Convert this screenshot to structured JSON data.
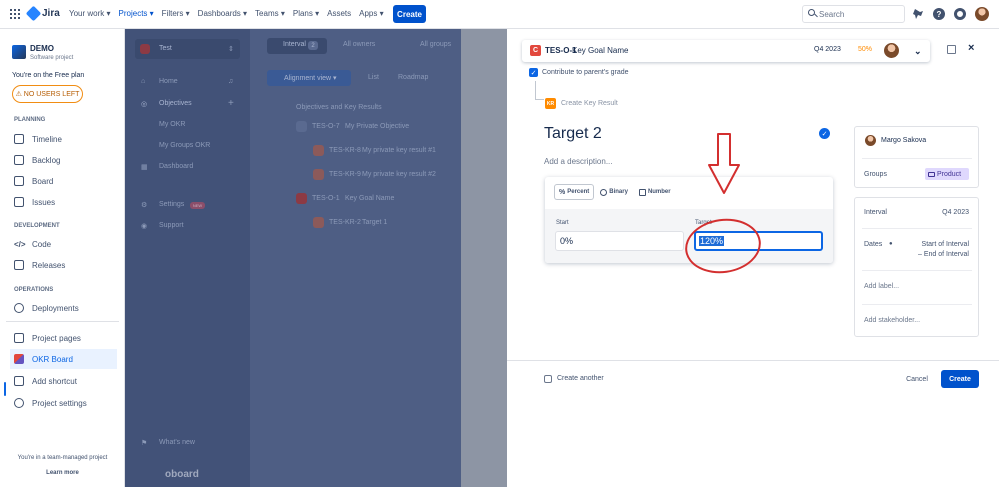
{
  "topnav": {
    "brand": "Jira",
    "items": [
      "Your work ▾",
      "Projects ▾",
      "Filters ▾",
      "Dashboards ▾",
      "Teams ▾",
      "Plans ▾",
      "Assets",
      "Apps ▾"
    ],
    "active_index": 1,
    "create_label": "Create",
    "search_placeholder": "Search",
    "help_label": "?"
  },
  "sidebar": {
    "project_name": "DEMO",
    "project_type": "Software project",
    "plan_notice": "You're on the Free plan",
    "no_users_label": "⚠ NO USERS LEFT",
    "sections": {
      "planning": "PLANNING",
      "development": "DEVELOPMENT",
      "operations": "OPERATIONS"
    },
    "items": {
      "timeline": "Timeline",
      "backlog": "Backlog",
      "board": "Board",
      "issues": "Issues",
      "code": "Code",
      "releases": "Releases",
      "deployments": "Deployments",
      "project_pages": "Project pages",
      "okr_board": "OKR Board",
      "add_shortcut": "Add shortcut",
      "project_settings": "Project settings"
    },
    "team_managed": "You're in a team-managed project",
    "learn_more": "Learn more"
  },
  "background_app": {
    "team": "Test",
    "nav": [
      "Home",
      "Objectives",
      "My OKR",
      "My Groups OKR",
      "Dashboard",
      "Settings",
      "Support",
      "What's new"
    ],
    "new_badge": "NEW",
    "brand": "oboard",
    "toolbar": {
      "interval": "Interval",
      "interval_count": "2",
      "all_owners": "All owners",
      "all_groups": "All groups",
      "alignment_view": "Alignment view ▾",
      "list": "List",
      "roadmap": "Roadmap"
    },
    "tree_header": "Objectives and Key Results",
    "rows": [
      {
        "key": "TES-O-7",
        "name": "My Private Objective"
      },
      {
        "key": "TES-KR-8",
        "name": "My private key result #1"
      },
      {
        "key": "TES-KR-9",
        "name": "My private key result #2"
      },
      {
        "key": "TES-O-1",
        "name": "Key Goal Name"
      },
      {
        "key": "TES-KR-2",
        "name": "Target 1"
      }
    ]
  },
  "panel": {
    "header": {
      "badge": "C",
      "key": "TES-O-1",
      "name": "Key Goal Name",
      "interval": "Q4 2023",
      "progress": "50%",
      "chevron": "⌄"
    },
    "close_label": "×",
    "contribute_label": "Contribute to parent's grade",
    "kr_badge": "KR",
    "create_kr_label": "Create Key Result",
    "title": "Target 2",
    "description_placeholder": "Add a description...",
    "metric_tabs": [
      "Percent",
      "Binary",
      "Number"
    ],
    "percent_glyph": "%",
    "start_label": "Start",
    "start_value": "0%",
    "target_label": "Target",
    "target_value": "120%",
    "owner": "Margo Sakova",
    "groups_label": "Groups",
    "group_value": "Product",
    "interval_label": "Interval",
    "interval_value": "Q4 2023",
    "dates_label": "Dates",
    "dates_value_1": "Start of Interval",
    "dates_value_2": "– End of Interval",
    "add_label": "Add label...",
    "add_stakeholder": "Add stakeholder...",
    "create_another": "Create another",
    "cancel": "Cancel",
    "create": "Create"
  },
  "colors": {
    "brand_blue": "#0052CC",
    "focus_blue": "#0C66E4",
    "objective_red": "#E2483D",
    "kr_orange": "#FF8B00",
    "annotation_red": "#D32F2F"
  }
}
